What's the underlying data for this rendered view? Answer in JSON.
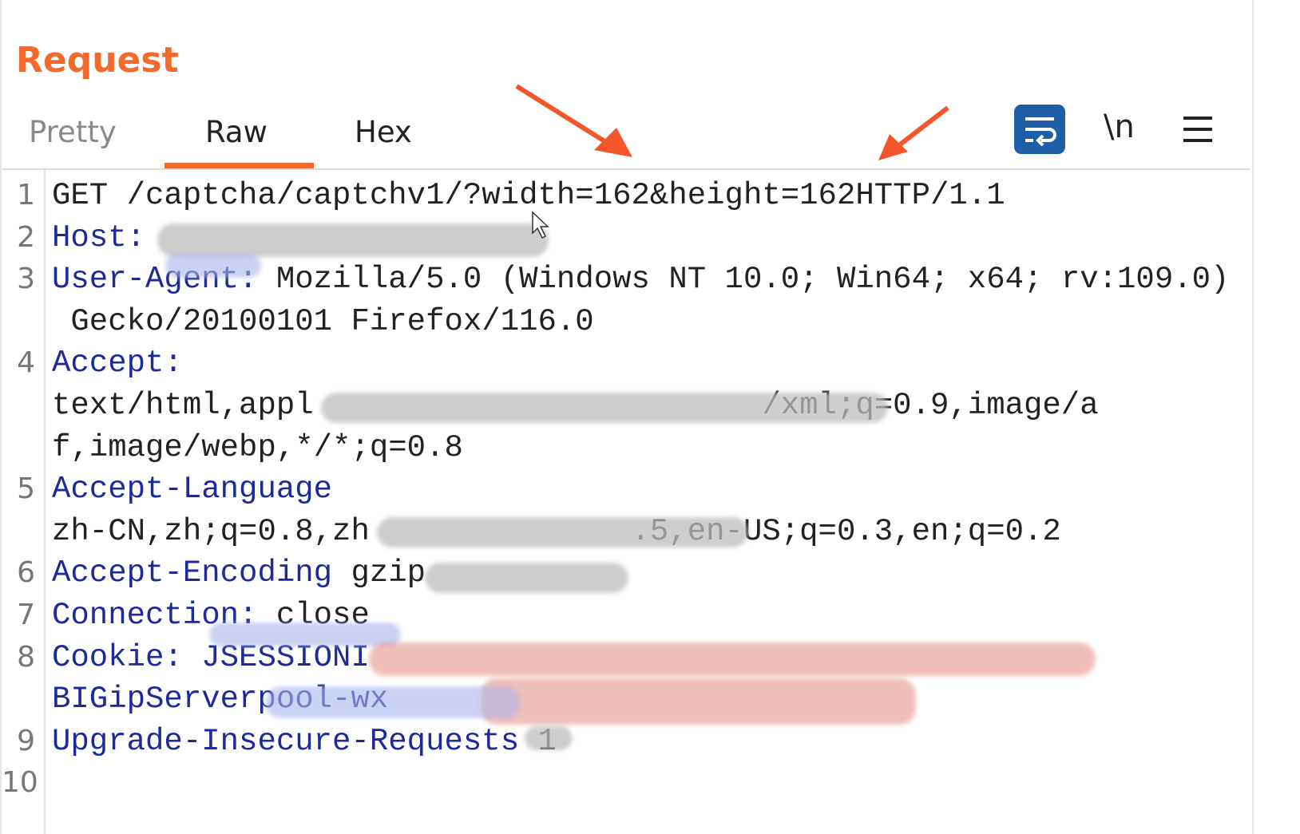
{
  "panel": {
    "title": "Request"
  },
  "tabs": [
    {
      "label": "Pretty",
      "active": false
    },
    {
      "label": "Raw",
      "active": true
    },
    {
      "label": "Hex",
      "active": false
    }
  ],
  "toolbar": {
    "wrap_icon": "word-wrap-icon",
    "newline_label": "\\n",
    "menu_icon": "hamburger-menu-icon",
    "accent": "#1e5fa8"
  },
  "colors": {
    "title": "#f26a2c",
    "header_key": "#1c2a9a",
    "text": "#222222"
  },
  "lines": [
    {
      "num": "1",
      "key": "",
      "value": "GET /captcha/captchv1/?width=162&height=162HTTP/1.1"
    },
    {
      "num": "2",
      "key": "Host:",
      "value": ""
    },
    {
      "num": "3",
      "key": "User-Agent:",
      "value": " Mozilla/5.0 (Windows NT 10.0; Win64; x64; rv:109.0)"
    },
    {
      "num": "",
      "key": "",
      "value": " Gecko/20100101 Firefox/116.0"
    },
    {
      "num": "4",
      "key": "Accept:",
      "value": ""
    },
    {
      "num": "",
      "key": "",
      "value": "text/html,appl                        /xml;q=0.9,image/a"
    },
    {
      "num": "",
      "key": "",
      "value": "f,image/webp,*/*;q=0.8"
    },
    {
      "num": "5",
      "key": "Accept-Language",
      "value": ""
    },
    {
      "num": "",
      "key": "",
      "value": "zh-CN,zh;q=0.8,zh              .5,en-US;q=0.3,en;q=0.2"
    },
    {
      "num": "6",
      "key": "Accept-Encoding",
      "value": " gzip"
    },
    {
      "num": "7",
      "key": "Connection:",
      "value": " close"
    },
    {
      "num": "8",
      "key": "Cookie: JSESSIONI",
      "value": ""
    },
    {
      "num": "",
      "key": "BIGipServerpool-wx",
      "value": ""
    },
    {
      "num": "9",
      "key": "Upgrade-Insecure-Requests",
      "value": " 1"
    },
    {
      "num": "10",
      "key": "",
      "value": ""
    }
  ]
}
